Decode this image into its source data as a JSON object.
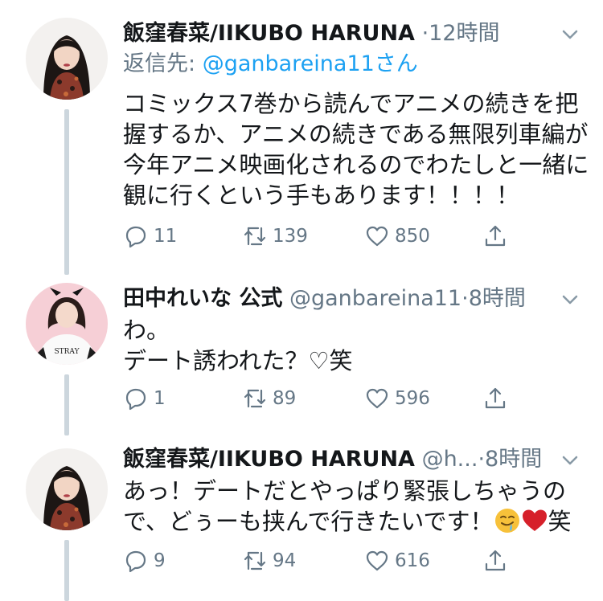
{
  "tweets": [
    {
      "name": "飯窪春菜/IIKUBO HARUNA",
      "handle": "",
      "time": "12時間",
      "reply_to_label": "返信先: ",
      "reply_to_handle": "@ganbareina11さん",
      "body_lines": [
        "コミックス7巻から読んでアニメの続きを把",
        "握するか、アニメの続きである無限列車編が",
        "今年アニメ映画化されるのでわたしと一緒に",
        "観に行くという手もあります！！！！"
      ],
      "replies": "11",
      "retweets": "139",
      "likes": "850"
    },
    {
      "name": "田中れいな 公式",
      "handle": "@ganbareina11",
      "time": "8時間",
      "body_lines": [
        "わ。",
        "デート誘われた？♡笑"
      ],
      "replies": "1",
      "retweets": "89",
      "likes": "596"
    },
    {
      "name": "飯窪春菜/IIKUBO HARUNA",
      "handle": "@h...",
      "time": "8時間",
      "body_lines": [
        "あっ！デートだとやっぱり緊張しちゃうの",
        "で、どぅーも挟んで行きたいです！"
      ],
      "body_suffix": "笑",
      "emoji_icons": [
        "drooling-face-emoji",
        "red-heart-emoji"
      ],
      "replies": "9",
      "retweets": "94",
      "likes": "616"
    }
  ],
  "separator": "·",
  "icons": {
    "reply": "reply-icon",
    "retweet": "retweet-icon",
    "like": "heart-icon",
    "share": "share-icon",
    "more": "chevron-down-icon"
  },
  "colors": {
    "text": "#14171a",
    "secondary": "#657786",
    "link": "#1da1f2",
    "thread_line": "#ccd6dd"
  }
}
